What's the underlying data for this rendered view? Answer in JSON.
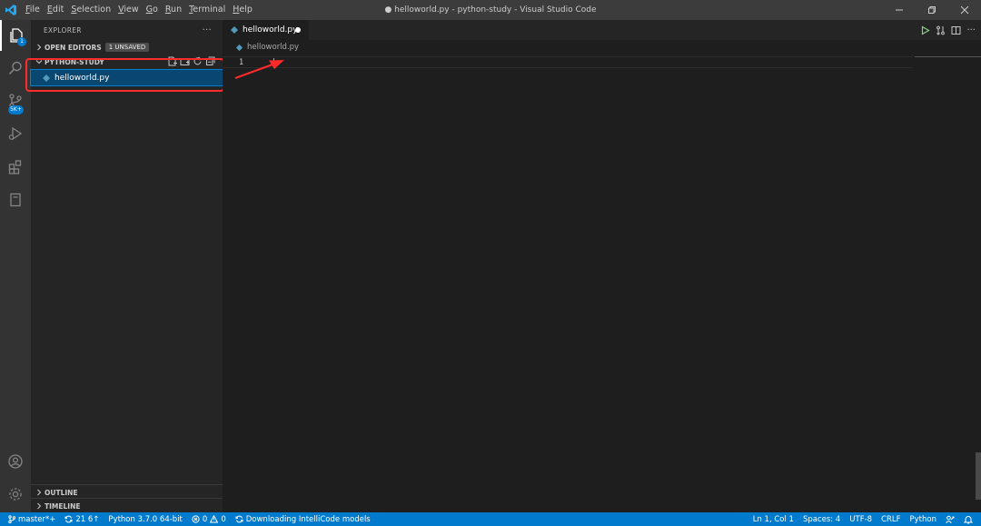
{
  "titlebar": {
    "menu": [
      "File",
      "Edit",
      "Selection",
      "View",
      "Go",
      "Run",
      "Terminal",
      "Help"
    ],
    "window_title": "● helloworld.py - python-study - Visual Studio Code"
  },
  "activitybar": {
    "explorer_badge": "1",
    "scm_badge": "5K+"
  },
  "sidebar": {
    "title": "EXPLORER",
    "more": "···",
    "open_editors": "OPEN EDITORS",
    "unsaved_badge": "1 UNSAVED",
    "folder": "PYTHON-STUDY",
    "file": "helloworld.py",
    "outline": "OUTLINE",
    "timeline": "TIMELINE"
  },
  "editor": {
    "tab_label": "helloworld.py",
    "breadcrumb": "helloworld.py",
    "line_number": "1",
    "more": "···"
  },
  "statusbar": {
    "branch": "master*+",
    "sync": "21 6↑",
    "interpreter": "Python 3.7.0 64-bit",
    "errors": "0",
    "warnings": "0",
    "task": "Downloading IntelliCode models",
    "position": "Ln 1, Col 1",
    "spaces": "Spaces: 4",
    "encoding": "UTF-8",
    "eol": "CRLF",
    "language": "Python"
  },
  "colors": {
    "accent": "#007acc",
    "highlight": "#ff2a2a",
    "file_icon": "#519aba"
  }
}
